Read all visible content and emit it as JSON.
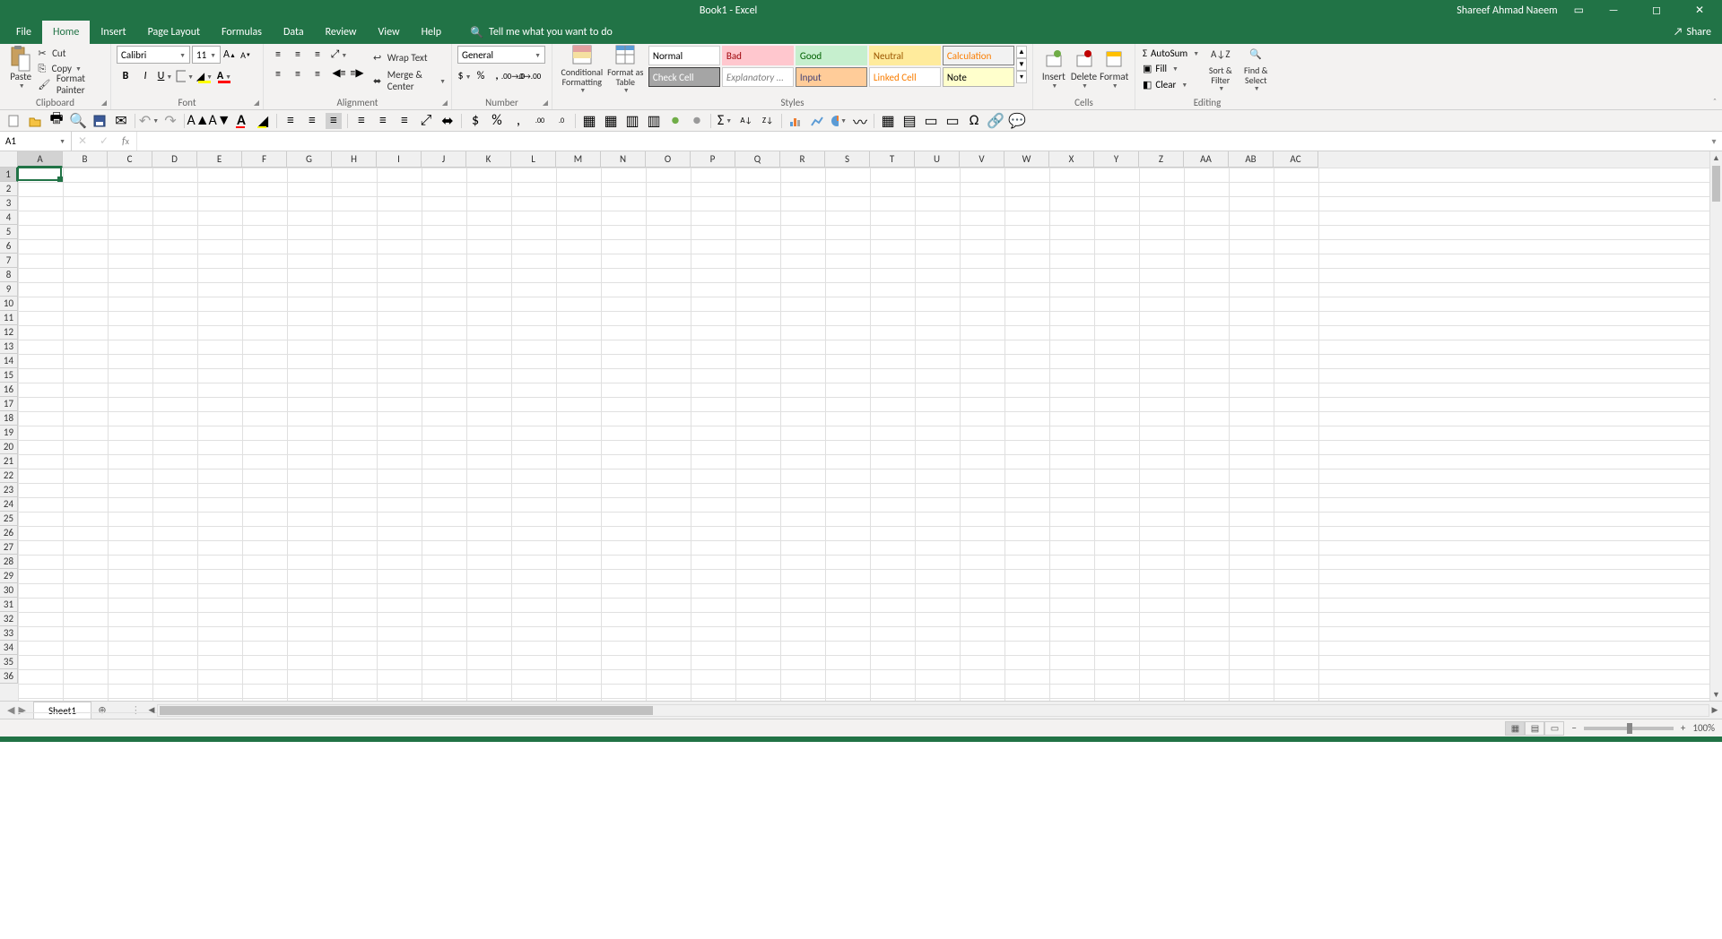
{
  "title": "Book1  -  Excel",
  "user": "Shareef Ahmad Naeem",
  "tabs": [
    "File",
    "Home",
    "Insert",
    "Page Layout",
    "Formulas",
    "Data",
    "Review",
    "View",
    "Help"
  ],
  "active_tab": "Home",
  "tellme": "Tell me what you want to do",
  "share": "Share",
  "clipboard": {
    "label": "Clipboard",
    "paste": "Paste",
    "cut": "Cut",
    "copy": "Copy",
    "painter": "Format Painter"
  },
  "font": {
    "label": "Font",
    "name": "Calibri",
    "size": "11"
  },
  "alignment": {
    "label": "Alignment",
    "wrap": "Wrap Text",
    "merge": "Merge & Center"
  },
  "number": {
    "label": "Number",
    "format": "General"
  },
  "styles": {
    "label": "Styles",
    "conditional": "Conditional Formatting",
    "formatas": "Format as Table",
    "cells": [
      {
        "t": "Normal",
        "bg": "#ffffff",
        "fg": "#000000",
        "b": "#ccc"
      },
      {
        "t": "Bad",
        "bg": "#ffc7ce",
        "fg": "#9c0006",
        "b": "#ffc7ce"
      },
      {
        "t": "Good",
        "bg": "#c6efce",
        "fg": "#006100",
        "b": "#c6efce"
      },
      {
        "t": "Neutral",
        "bg": "#ffeb9c",
        "fg": "#9c5700",
        "b": "#ffeb9c"
      },
      {
        "t": "Calculation",
        "bg": "#f2f2f2",
        "fg": "#fa7d00",
        "b": "#7f7f7f"
      },
      {
        "t": "Check Cell",
        "bg": "#a5a5a5",
        "fg": "#ffffff",
        "b": "#3f3f3f"
      },
      {
        "t": "Explanatory ...",
        "bg": "#ffffff",
        "fg": "#7f7f7f",
        "b": "#ccc",
        "i": true
      },
      {
        "t": "Input",
        "bg": "#ffcc99",
        "fg": "#3f3f76",
        "b": "#7f7f7f"
      },
      {
        "t": "Linked Cell",
        "bg": "#ffffff",
        "fg": "#fa7d00",
        "b": "#ccc"
      },
      {
        "t": "Note",
        "bg": "#ffffcc",
        "fg": "#000000",
        "b": "#b2b2b2"
      }
    ]
  },
  "cells_group": {
    "label": "Cells",
    "insert": "Insert",
    "delete": "Delete",
    "format": "Format"
  },
  "editing": {
    "label": "Editing",
    "autosum": "AutoSum",
    "fill": "Fill",
    "clear": "Clear",
    "sort": "Sort & Filter",
    "find": "Find & Select"
  },
  "name_box": "A1",
  "columns": [
    "A",
    "B",
    "C",
    "D",
    "E",
    "F",
    "G",
    "H",
    "I",
    "J",
    "K",
    "L",
    "M",
    "N",
    "O",
    "P",
    "Q",
    "R",
    "S",
    "T",
    "U",
    "V",
    "W",
    "X",
    "Y",
    "Z",
    "AA",
    "AB",
    "AC"
  ],
  "rows": 36,
  "selected_cell": {
    "col": 0,
    "row": 0
  },
  "sheet": "Sheet1",
  "zoom": "100%"
}
